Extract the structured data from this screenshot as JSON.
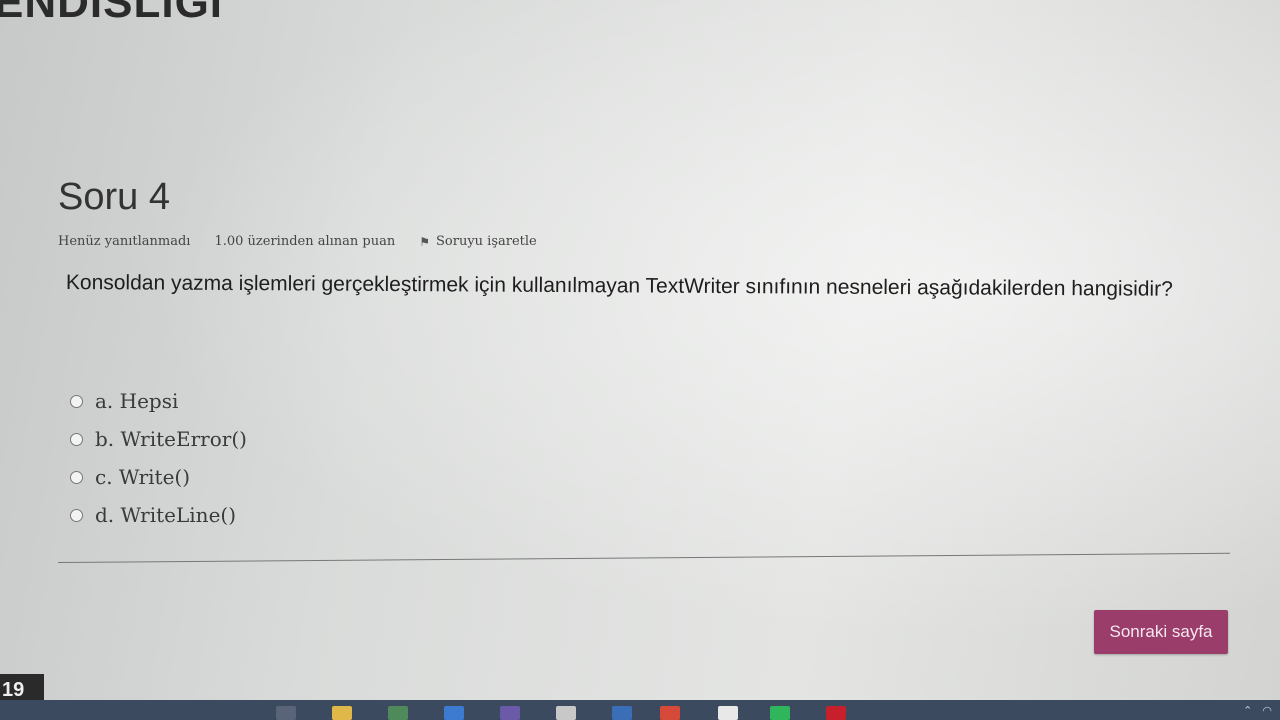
{
  "header": {
    "title": "ENDISLIGI"
  },
  "question": {
    "title": "Soru 4",
    "status": "Henüz yanıtlanmadı",
    "points": "1.00 üzerinden alınan puan",
    "flag_label": "Soruyu işaretle",
    "text": "Konsoldan yazma işlemleri gerçekleştirmek için kullanılmayan TextWriter sınıfının nesneleri aşağıdakilerden hangisidir?",
    "answers": [
      {
        "label": "a. Hepsi"
      },
      {
        "label": "b. WriteError()"
      },
      {
        "label": "c. Write()"
      },
      {
        "label": "d. WriteLine()"
      }
    ]
  },
  "footer": {
    "next_label": "Sonraki sayfa"
  },
  "side": {
    "badge": "19"
  },
  "taskbar": {
    "icons": [
      "task-view-icon",
      "file-explorer-icon",
      "store-icon",
      "calculator-icon",
      "visual-studio-icon",
      "app-icon",
      "edge-icon",
      "chrome-icon",
      "document-icon",
      "spotify-icon",
      "netflix-icon"
    ],
    "accent_colors": [
      "#3c4a60",
      "#9b3d6a"
    ]
  }
}
